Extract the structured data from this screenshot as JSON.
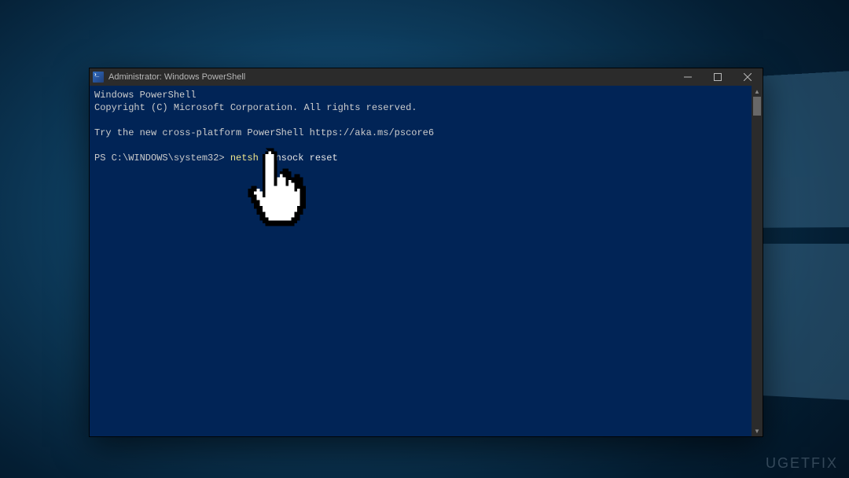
{
  "window": {
    "title": "Administrator: Windows PowerShell",
    "icon_name": "powershell-icon"
  },
  "console": {
    "header_line1": "Windows PowerShell",
    "header_line2": "Copyright (C) Microsoft Corporation. All rights reserved.",
    "tip_line": "Try the new cross-platform PowerShell https://aka.ms/pscore6",
    "prompt_prefix": "PS C:\\WINDOWS\\system32> ",
    "command_token": "netsh",
    "command_rest": " Winsock reset"
  },
  "watermark": "UGETFIX",
  "colors": {
    "console_bg": "#012456",
    "titlebar_bg": "#2b2b2b",
    "cmd_yellow": "#f0e68c"
  }
}
